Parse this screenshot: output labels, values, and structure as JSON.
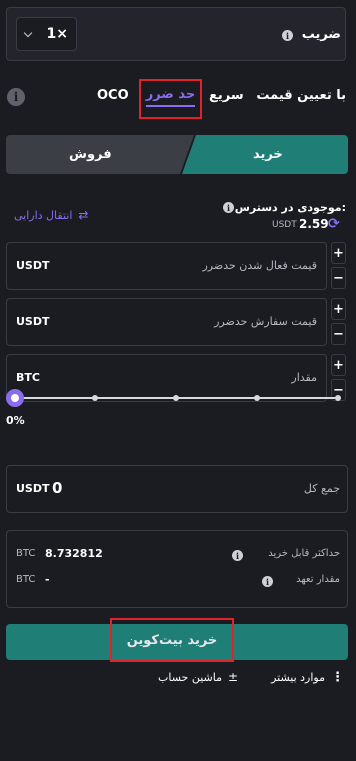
{
  "header": {
    "multiplier_label": "ضریب",
    "multiplier_value": "1×",
    "chevron": "chevron-down-icon"
  },
  "tabs": [
    {
      "label": "با تعیین قیمت"
    },
    {
      "label": "سریع"
    },
    {
      "label": "حد ضرر"
    },
    {
      "label": "OCO"
    }
  ],
  "side": {
    "buy": "خرید",
    "sell": "فروش"
  },
  "balance": {
    "label": "موجودی در دسترس:",
    "amount": "2.59",
    "unit": "USDT",
    "transfer_label": "انتقال دارایی"
  },
  "fields": {
    "stop_price": {
      "label": "قیمت فعال شدن حدضرر",
      "unit": "USDT"
    },
    "order_price": {
      "label": "قیمت سفارش حدضرر",
      "unit": "USDT"
    },
    "amount": {
      "label": "مقدار",
      "unit": "BTC"
    }
  },
  "slider": {
    "percent_label": "0%",
    "value": 0
  },
  "total": {
    "label": "جمع کل",
    "value": "0",
    "unit": "USDT"
  },
  "summary": {
    "max_buy_label": "حداکثر قابل خرید",
    "max_buy_value": "8.732812",
    "max_buy_unit": "BTC",
    "commitment_label": "مقدار تعهد",
    "commitment_value": "-",
    "commitment_unit": "BTC"
  },
  "submit": {
    "label": "خرید بیت‌کوین"
  },
  "footer": {
    "more_label": "موارد بیشتر",
    "calculator_label": "ماشین حساب"
  },
  "colors": {
    "accent_teal": "#1f7f76",
    "purple": "#8a6cf0",
    "highlight_red": "#e0222a",
    "background": "#1b1c22"
  }
}
